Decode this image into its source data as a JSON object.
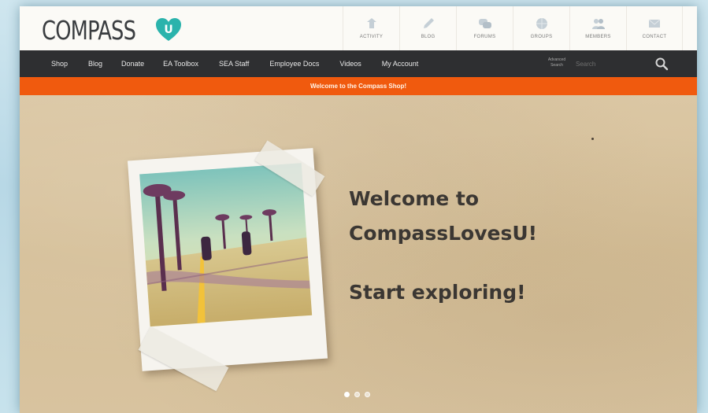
{
  "header": {
    "logo_text": "COMPASS",
    "logo_mark_letter": "U",
    "top_icons": [
      {
        "label": "ACTIVITY",
        "icon": "activity-icon"
      },
      {
        "label": "BLOG",
        "icon": "pen-icon"
      },
      {
        "label": "FORUMS",
        "icon": "chat-bubbles-icon"
      },
      {
        "label": "GROUPS",
        "icon": "globe-icon"
      },
      {
        "label": "MEMBERS",
        "icon": "people-icon"
      },
      {
        "label": "CONTACT",
        "icon": "envelope-icon"
      }
    ]
  },
  "nav": {
    "links": [
      "Shop",
      "Blog",
      "Donate",
      "EA Toolbox",
      "SEA Staff",
      "Employee Docs",
      "Videos",
      "My Account"
    ],
    "advanced_search": "Advanced Search",
    "search_placeholder": "Search",
    "search_icon": "search-icon"
  },
  "notice": {
    "text": "Welcome to the Compass Shop!"
  },
  "hero": {
    "heading_line1": "Welcome to",
    "heading_line2": "CompassLovesU!",
    "subheading": "Start exploring!",
    "slides_total": 3,
    "active_slide": 1
  },
  "colors": {
    "accent_teal": "#2bb3ac",
    "nav_bg": "#2e2f31",
    "notice_bg": "#f05a0e",
    "hero_bg": "#d8c39f"
  }
}
